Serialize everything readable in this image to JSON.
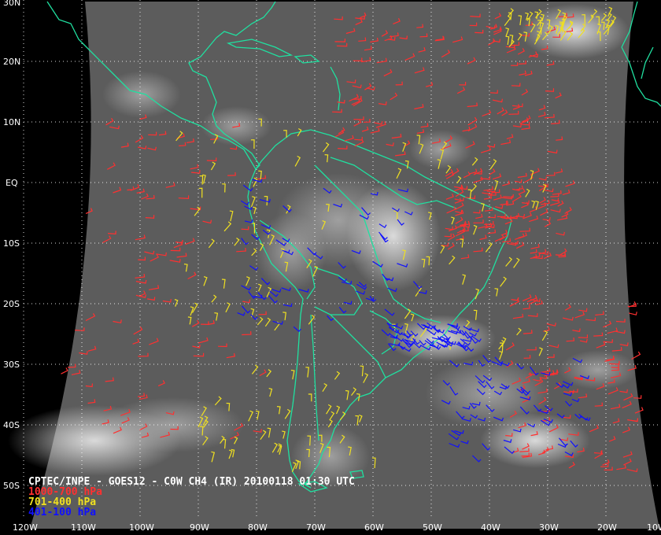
{
  "caption": "CPTEC/INPE - GOES12 - C0W CH4 (IR) 20100118 01:30 UTC",
  "legend": [
    {
      "label": "1000-700 hPa",
      "color": "#ff3030"
    },
    {
      "label": "701-400 hPa",
      "color": "#f0e020"
    },
    {
      "label": "401-100 hPa",
      "color": "#1010ff"
    }
  ],
  "colors": {
    "coast": "#20e0a0",
    "grid": "#ffffff",
    "background": "#000000"
  },
  "lat_labels": [
    "30N",
    "20N",
    "10N",
    "EQ",
    "10S",
    "20S",
    "30S",
    "40S",
    "50S"
  ],
  "lon_labels": [
    "120W",
    "110W",
    "100W",
    "90W",
    "80W",
    "70W",
    "60W",
    "50W",
    "40W",
    "30W",
    "20W",
    "10W"
  ],
  "lat_values": [
    30,
    20,
    10,
    0,
    -10,
    -20,
    -30,
    -40,
    -50
  ],
  "lon_values": [
    -120,
    -110,
    -100,
    -90,
    -80,
    -70,
    -60,
    -50,
    -40,
    -30,
    -20,
    -10
  ]
}
